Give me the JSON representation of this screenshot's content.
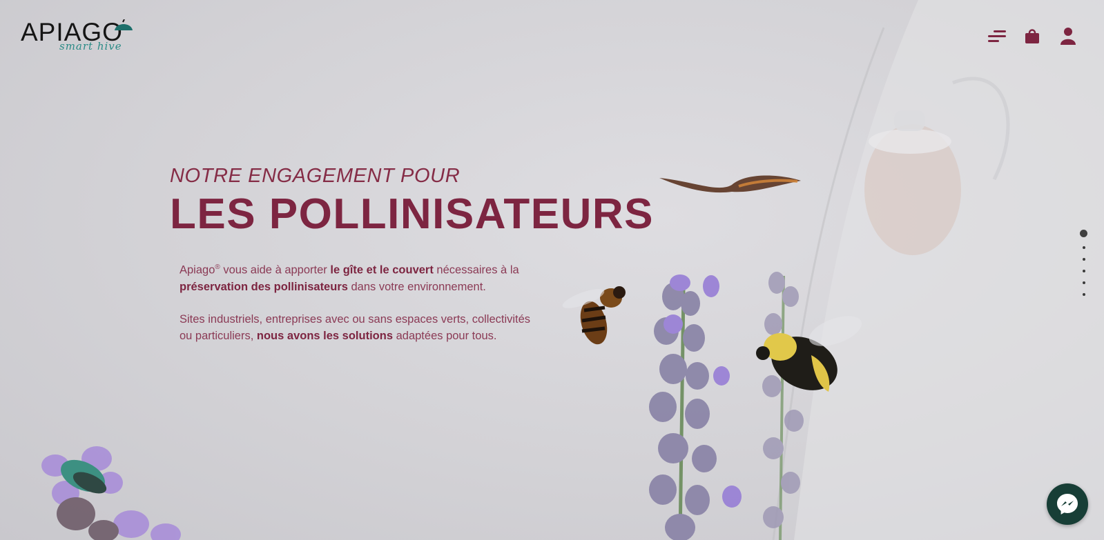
{
  "brand": {
    "name": "APIAGO",
    "tagline": "smart hive"
  },
  "header": {
    "icons": [
      "menu-icon",
      "shopping-bag-icon",
      "user-icon"
    ]
  },
  "hero": {
    "kicker": "NOTRE ENGAGEMENT POUR",
    "title": "LES POLLINISATEURS",
    "p1": {
      "a": "Apiago",
      "reg": "®",
      "b": " vous aide à apporter ",
      "c": "le gîte et le couvert",
      "d": " nécessaires à la ",
      "e": "préservation des pollinisateurs",
      "f": " dans votre environnement."
    },
    "p2": {
      "a": "Sites industriels, entreprises avec ou sans espaces verts, collectivités ou particuliers, ",
      "b": "nous avons les solutions",
      "c": " adaptées pour tous."
    }
  },
  "section_nav": {
    "count": 6,
    "active_index": 0
  },
  "chat": {
    "icon": "messenger-icon"
  },
  "colors": {
    "brand": "#7d2541",
    "teal": "#2a8b86",
    "chat_bg": "#173e36",
    "background": "#d6d5d9"
  }
}
